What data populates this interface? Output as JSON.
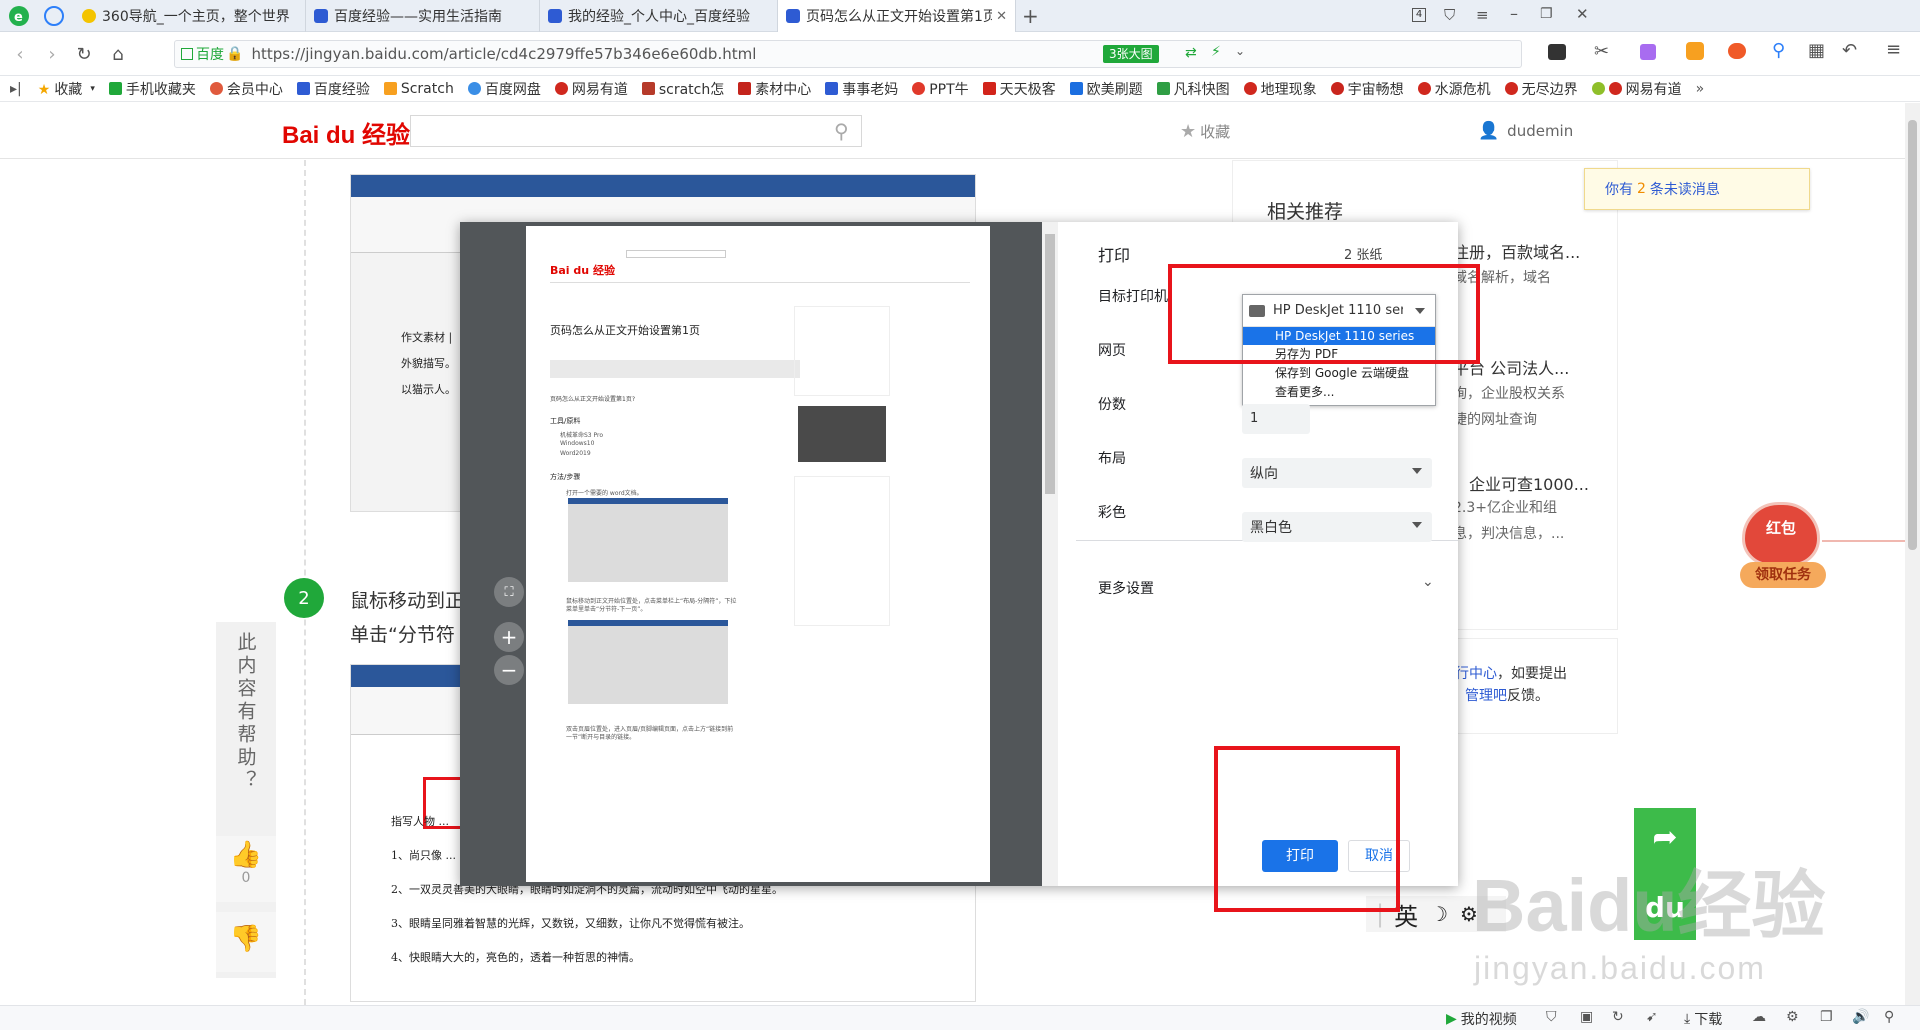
{
  "tabs": [
    {
      "label": "360导航_一个主页，整个世界",
      "active": false
    },
    {
      "label": "百度经验——实用生活指南",
      "active": false
    },
    {
      "label": "我的经验_个人中心_百度经验",
      "active": false
    },
    {
      "label": "页码怎么从正文开始设置第1页-百",
      "active": true
    }
  ],
  "window": {
    "tab_count": "4"
  },
  "address": {
    "site_badge": "百度",
    "url": "https://jingyan.baidu.com/article/cd4c2979ffe57b346e6e60db.html",
    "image_badge": "3张大图"
  },
  "bookmarks": [
    "收藏",
    "手机收藏夹",
    "会员中心",
    "百度经验",
    "Scratch",
    "百度网盘",
    "网易有道",
    "scratch怎",
    "素材中心",
    "事事老妈",
    "PPT牛",
    "天天极客",
    "欧美刷题",
    "凡科快图",
    "地理现象",
    "宇宙畅想",
    "水源危机",
    "无尽边界",
    "网易有道"
  ],
  "site": {
    "logo": "Bai du 经验",
    "search_placeholder": "",
    "collect_label": "收藏",
    "username": "dudemin",
    "unread_notice_prefix": "你有",
    "unread_count": "2",
    "unread_notice_suffix": "条未读消息"
  },
  "article": {
    "step_number": "2",
    "step_text_line1": "鼠标移动到正",
    "step_text_line2": "单击“分节符",
    "helpful_question": "此内容有帮助？",
    "like_count": "0"
  },
  "sidebar": {
    "section_title": "相关推荐",
    "items": [
      {
        "title": "注册，百款域名...",
        "desc": "域名解析，域名"
      },
      {
        "title": "平台 公司法人...",
        "desc": "询，企业股权关系"
      },
      {
        "title": "",
        "desc": "捷的网址查询"
      },
      {
        "title": "企业可查1000...",
        "desc": "2.3+亿企业和组"
      },
      {
        "title": "",
        "desc": "息，判决信息，..."
      }
    ],
    "feedback_line1_link": "行中心",
    "feedback_line1_suffix": "，如要提出",
    "feedback_line2_link": "管理吧",
    "feedback_line2_suffix": "反馈。",
    "redpacket_label": "红包",
    "task_label": "领取任务"
  },
  "print": {
    "title": "打印",
    "sheet_count": "2 张纸",
    "destination_label": "目标打印机",
    "destination_selected": "HP DeskJet 1110 series",
    "destination_options": [
      "HP DeskJet 1110 series",
      "另存为 PDF",
      "保存到 Google 云端硬盘",
      "查看更多..."
    ],
    "pages_label": "网页",
    "copies_label": "份数",
    "copies_value": "1",
    "layout_label": "布局",
    "layout_value": "纵向",
    "color_label": "彩色",
    "color_value": "黑白色",
    "more_settings": "更多设置",
    "print_button": "打印",
    "cancel_button": "取消"
  },
  "preview_page": {
    "title": "页码怎么从正文开始设置第1页",
    "intro": "页码怎么从正文开始设置第1页?",
    "tools_heading": "工具/原料",
    "tools": [
      "机械革命S3 Pro",
      "Windows10",
      "Word2019"
    ],
    "method_heading": "方法/步骤",
    "step1": "打开一个需要的 word文档。",
    "step2": "鼠标移动到正文开始位置处，点击菜单栏上“布局-分隔符”，下拉菜单里单击“分节符-下一页”。",
    "step3": "双击页眉位置处，进入页眉/页脚编辑页面，点击上方“链接到前一节”断开与目录的链接。"
  },
  "ime": {
    "lang": "英"
  },
  "statusbar": {
    "video": "我的视频",
    "download": "下载"
  },
  "watermark": {
    "text": "Baidu经验",
    "url": "jingyan.baidu.com"
  },
  "colors": {
    "accent_green": "#20a83a",
    "dialog_blue": "#1a73e8",
    "alert_red": "#e8141b"
  }
}
